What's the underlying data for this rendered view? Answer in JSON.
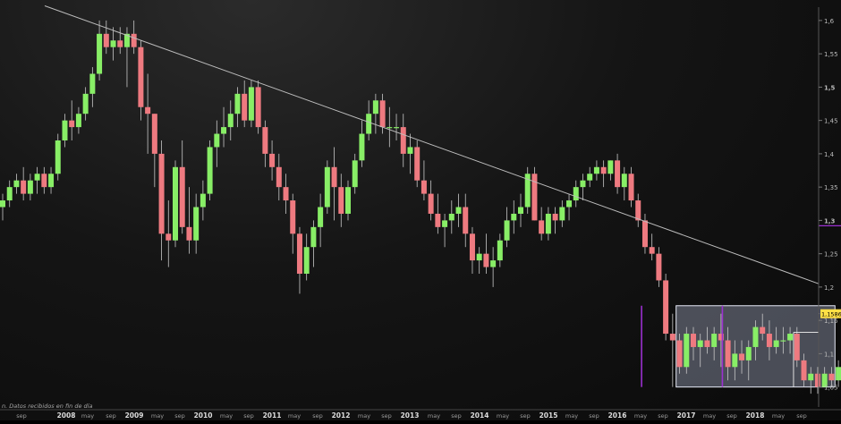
{
  "chart_data": {
    "type": "candlestick",
    "ylim": [
      1.02,
      1.62
    ],
    "yticks": [
      1.05,
      1.1,
      1.15,
      1.2,
      1.25,
      1.3,
      1.35,
      1.4,
      1.45,
      1.5,
      1.55,
      1.6
    ],
    "ytick_labels": [
      "1,05",
      "1,1",
      "1,15",
      "1,2",
      "1,25",
      "1,3",
      "1,35",
      "1,4",
      "1,45",
      "1,5",
      "1,55",
      "1,6"
    ],
    "xtick_labels": [
      "sep",
      "2008",
      "may",
      "sep",
      "2009",
      "may",
      "sep",
      "2010",
      "may",
      "sep",
      "2011",
      "may",
      "sep",
      "2012",
      "may",
      "sep",
      "2013",
      "may",
      "sep",
      "2014",
      "may",
      "sep",
      "2015",
      "may",
      "sep",
      "2016",
      "may",
      "sep",
      "2017",
      "may",
      "sep",
      "2018",
      "may",
      "sep"
    ],
    "last_price": "1,1586",
    "footnote": "n. Datos recibidos en fin de día",
    "colors": {
      "up": "#88ee66",
      "down": "#ee7a80",
      "trendline": "#bdbdbd",
      "box": "#c8d0f0",
      "marker": "#9b30d0"
    },
    "candles": [
      [
        1.32,
        1.34,
        1.3,
        1.33
      ],
      [
        1.33,
        1.36,
        1.32,
        1.35
      ],
      [
        1.35,
        1.37,
        1.34,
        1.36
      ],
      [
        1.36,
        1.38,
        1.33,
        1.34
      ],
      [
        1.34,
        1.37,
        1.33,
        1.36
      ],
      [
        1.36,
        1.38,
        1.34,
        1.37
      ],
      [
        1.37,
        1.38,
        1.34,
        1.35
      ],
      [
        1.35,
        1.38,
        1.34,
        1.37
      ],
      [
        1.37,
        1.43,
        1.36,
        1.42
      ],
      [
        1.42,
        1.46,
        1.41,
        1.45
      ],
      [
        1.45,
        1.48,
        1.42,
        1.44
      ],
      [
        1.44,
        1.47,
        1.43,
        1.46
      ],
      [
        1.46,
        1.5,
        1.45,
        1.49
      ],
      [
        1.49,
        1.53,
        1.47,
        1.52
      ],
      [
        1.52,
        1.6,
        1.51,
        1.58
      ],
      [
        1.58,
        1.6,
        1.55,
        1.56
      ],
      [
        1.56,
        1.59,
        1.54,
        1.57
      ],
      [
        1.57,
        1.59,
        1.55,
        1.56
      ],
      [
        1.56,
        1.59,
        1.5,
        1.58
      ],
      [
        1.58,
        1.6,
        1.55,
        1.56
      ],
      [
        1.56,
        1.57,
        1.45,
        1.47
      ],
      [
        1.47,
        1.52,
        1.4,
        1.46
      ],
      [
        1.46,
        1.46,
        1.35,
        1.4
      ],
      [
        1.4,
        1.42,
        1.24,
        1.28
      ],
      [
        1.28,
        1.33,
        1.23,
        1.27
      ],
      [
        1.27,
        1.39,
        1.26,
        1.38
      ],
      [
        1.38,
        1.42,
        1.28,
        1.29
      ],
      [
        1.29,
        1.35,
        1.25,
        1.27
      ],
      [
        1.27,
        1.34,
        1.25,
        1.32
      ],
      [
        1.32,
        1.36,
        1.3,
        1.34
      ],
      [
        1.34,
        1.42,
        1.33,
        1.41
      ],
      [
        1.41,
        1.45,
        1.38,
        1.43
      ],
      [
        1.43,
        1.47,
        1.41,
        1.44
      ],
      [
        1.44,
        1.48,
        1.42,
        1.46
      ],
      [
        1.46,
        1.5,
        1.44,
        1.49
      ],
      [
        1.49,
        1.51,
        1.44,
        1.45
      ],
      [
        1.45,
        1.51,
        1.44,
        1.5
      ],
      [
        1.5,
        1.51,
        1.43,
        1.44
      ],
      [
        1.44,
        1.45,
        1.38,
        1.4
      ],
      [
        1.4,
        1.42,
        1.36,
        1.38
      ],
      [
        1.38,
        1.4,
        1.33,
        1.35
      ],
      [
        1.35,
        1.37,
        1.31,
        1.33
      ],
      [
        1.33,
        1.34,
        1.25,
        1.28
      ],
      [
        1.28,
        1.29,
        1.19,
        1.22
      ],
      [
        1.22,
        1.28,
        1.21,
        1.26
      ],
      [
        1.26,
        1.3,
        1.23,
        1.29
      ],
      [
        1.29,
        1.34,
        1.26,
        1.32
      ],
      [
        1.32,
        1.39,
        1.31,
        1.38
      ],
      [
        1.38,
        1.41,
        1.3,
        1.35
      ],
      [
        1.35,
        1.37,
        1.29,
        1.31
      ],
      [
        1.31,
        1.36,
        1.3,
        1.35
      ],
      [
        1.35,
        1.4,
        1.34,
        1.39
      ],
      [
        1.39,
        1.45,
        1.38,
        1.43
      ],
      [
        1.43,
        1.48,
        1.42,
        1.46
      ],
      [
        1.46,
        1.49,
        1.43,
        1.48
      ],
      [
        1.48,
        1.49,
        1.43,
        1.44
      ],
      [
        1.44,
        1.47,
        1.41,
        1.44
      ],
      [
        1.44,
        1.46,
        1.42,
        1.44
      ],
      [
        1.44,
        1.46,
        1.38,
        1.4
      ],
      [
        1.4,
        1.43,
        1.37,
        1.41
      ],
      [
        1.41,
        1.42,
        1.35,
        1.36
      ],
      [
        1.36,
        1.39,
        1.33,
        1.34
      ],
      [
        1.34,
        1.36,
        1.3,
        1.31
      ],
      [
        1.31,
        1.34,
        1.28,
        1.29
      ],
      [
        1.29,
        1.31,
        1.26,
        1.3
      ],
      [
        1.3,
        1.33,
        1.28,
        1.31
      ],
      [
        1.31,
        1.34,
        1.29,
        1.32
      ],
      [
        1.32,
        1.34,
        1.26,
        1.28
      ],
      [
        1.28,
        1.29,
        1.22,
        1.24
      ],
      [
        1.24,
        1.26,
        1.22,
        1.25
      ],
      [
        1.25,
        1.28,
        1.22,
        1.23
      ],
      [
        1.23,
        1.26,
        1.2,
        1.24
      ],
      [
        1.24,
        1.28,
        1.23,
        1.27
      ],
      [
        1.27,
        1.32,
        1.26,
        1.3
      ],
      [
        1.3,
        1.33,
        1.28,
        1.31
      ],
      [
        1.31,
        1.34,
        1.29,
        1.32
      ],
      [
        1.32,
        1.38,
        1.31,
        1.37
      ],
      [
        1.37,
        1.38,
        1.3,
        1.3
      ],
      [
        1.3,
        1.32,
        1.27,
        1.28
      ],
      [
        1.28,
        1.32,
        1.27,
        1.31
      ],
      [
        1.31,
        1.32,
        1.28,
        1.3
      ],
      [
        1.3,
        1.33,
        1.29,
        1.32
      ],
      [
        1.32,
        1.34,
        1.3,
        1.33
      ],
      [
        1.33,
        1.36,
        1.32,
        1.35
      ],
      [
        1.35,
        1.37,
        1.33,
        1.36
      ],
      [
        1.36,
        1.38,
        1.35,
        1.37
      ],
      [
        1.37,
        1.39,
        1.36,
        1.38
      ],
      [
        1.38,
        1.39,
        1.35,
        1.37
      ],
      [
        1.37,
        1.39,
        1.36,
        1.39
      ],
      [
        1.39,
        1.4,
        1.34,
        1.35
      ],
      [
        1.35,
        1.38,
        1.33,
        1.37
      ],
      [
        1.37,
        1.38,
        1.32,
        1.33
      ],
      [
        1.33,
        1.34,
        1.29,
        1.3
      ],
      [
        1.3,
        1.31,
        1.25,
        1.26
      ],
      [
        1.26,
        1.28,
        1.24,
        1.25
      ],
      [
        1.25,
        1.26,
        1.2,
        1.21
      ],
      [
        1.21,
        1.22,
        1.12,
        1.13
      ],
      [
        1.13,
        1.16,
        1.05,
        1.12
      ],
      [
        1.12,
        1.13,
        1.07,
        1.08
      ],
      [
        1.08,
        1.14,
        1.07,
        1.13
      ],
      [
        1.13,
        1.14,
        1.09,
        1.11
      ],
      [
        1.11,
        1.13,
        1.08,
        1.12
      ],
      [
        1.12,
        1.14,
        1.1,
        1.11
      ],
      [
        1.11,
        1.14,
        1.09,
        1.13
      ],
      [
        1.13,
        1.16,
        1.08,
        1.12
      ],
      [
        1.12,
        1.14,
        1.06,
        1.08
      ],
      [
        1.08,
        1.12,
        1.06,
        1.1
      ],
      [
        1.1,
        1.12,
        1.07,
        1.09
      ],
      [
        1.09,
        1.12,
        1.06,
        1.11
      ],
      [
        1.11,
        1.15,
        1.09,
        1.14
      ],
      [
        1.14,
        1.16,
        1.12,
        1.13
      ],
      [
        1.13,
        1.15,
        1.09,
        1.11
      ],
      [
        1.11,
        1.14,
        1.1,
        1.12
      ],
      [
        1.12,
        1.14,
        1.1,
        1.12
      ],
      [
        1.12,
        1.14,
        1.1,
        1.13
      ],
      [
        1.13,
        1.14,
        1.08,
        1.09
      ],
      [
        1.09,
        1.1,
        1.05,
        1.06
      ],
      [
        1.06,
        1.08,
        1.04,
        1.07
      ],
      [
        1.07,
        1.08,
        1.04,
        1.05
      ],
      [
        1.05,
        1.08,
        1.05,
        1.07
      ],
      [
        1.07,
        1.08,
        1.05,
        1.06
      ],
      [
        1.06,
        1.09,
        1.05,
        1.08
      ],
      [
        1.08,
        1.13,
        1.08,
        1.12
      ],
      [
        1.12,
        1.15,
        1.12,
        1.14
      ],
      [
        1.14,
        1.19,
        1.13,
        1.18
      ],
      [
        1.18,
        1.2,
        1.16,
        1.19
      ],
      [
        1.19,
        1.21,
        1.17,
        1.18
      ],
      [
        1.18,
        1.2,
        1.16,
        1.17
      ],
      [
        1.17,
        1.2,
        1.16,
        1.19
      ],
      [
        1.19,
        1.21,
        1.17,
        1.2
      ],
      [
        1.2,
        1.25,
        1.19,
        1.24
      ],
      [
        1.24,
        1.25,
        1.22,
        1.23
      ],
      [
        1.23,
        1.25,
        1.2,
        1.21
      ],
      [
        1.21,
        1.22,
        1.17,
        1.18
      ],
      [
        1.18,
        1.19,
        1.15,
        1.17
      ],
      [
        1.17,
        1.18,
        1.15,
        1.17
      ],
      [
        1.17,
        1.18,
        1.15,
        1.16
      ]
    ]
  }
}
